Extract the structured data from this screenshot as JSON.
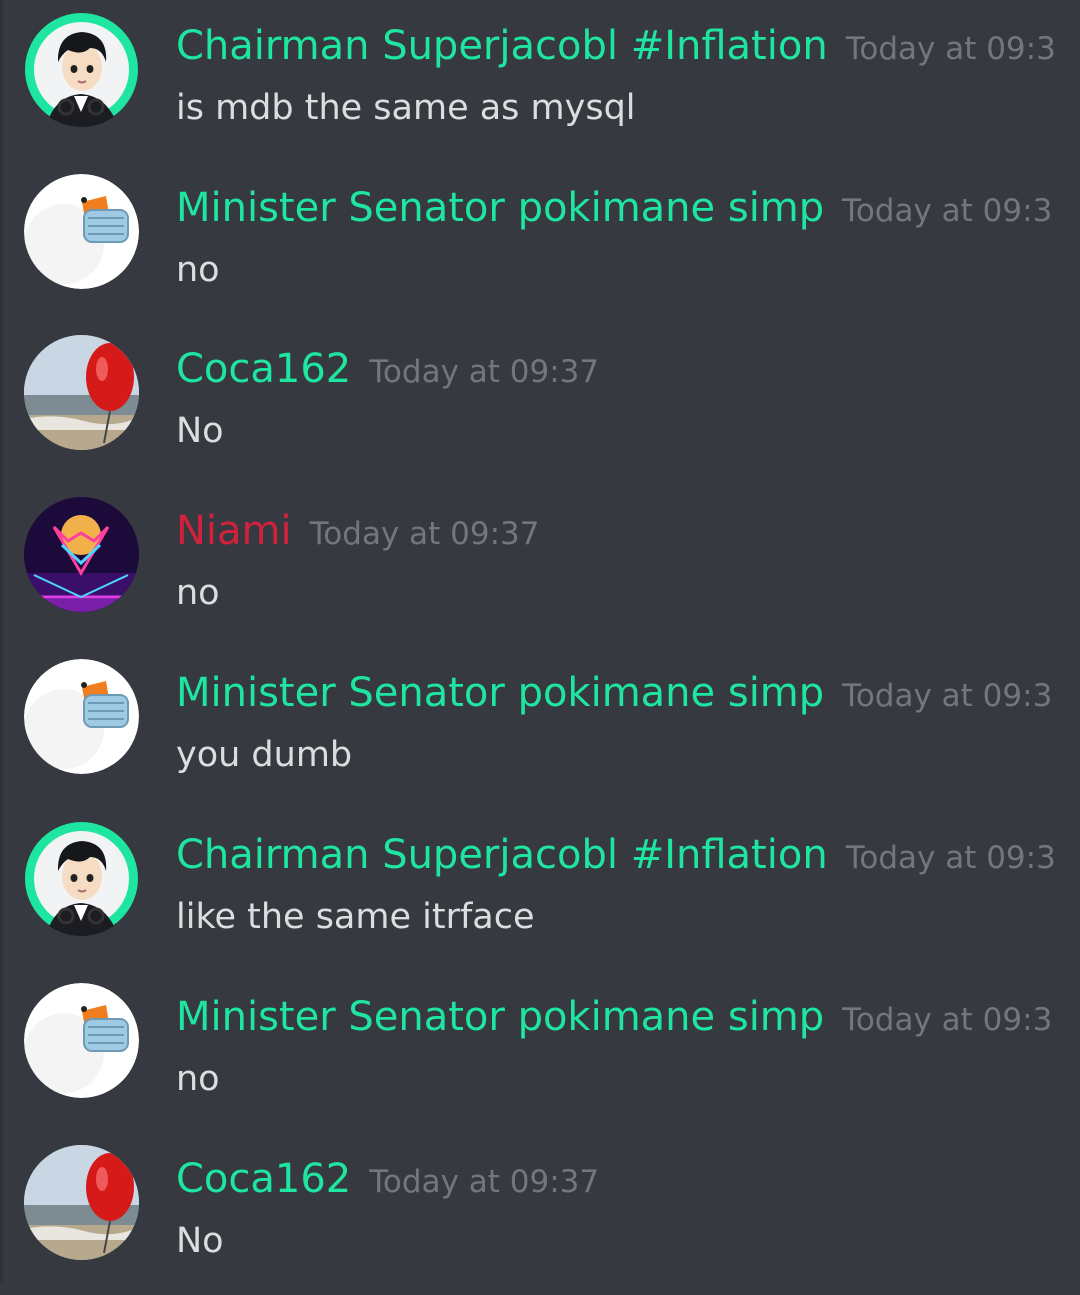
{
  "colors": {
    "background": "#36393f",
    "username_green": "#1ee6a0",
    "username_red": "#d1213c",
    "timestamp": "#72767d",
    "message_text": "#dcddde"
  },
  "messages": [
    {
      "author": "Chairman Superjacobl #Inflation",
      "author_color": "#1ee6a0",
      "timestamp": "Today at 09:3",
      "content": "is mdb the same as mysql",
      "avatar": "anime-boy-avatar"
    },
    {
      "author": "Minister Senator pokimane simp",
      "author_color": "#1ee6a0",
      "timestamp": "Today at 09:3",
      "content": "no",
      "avatar": "goose-mask-avatar"
    },
    {
      "author": "Coca162",
      "author_color": "#1ee6a0",
      "timestamp": "Today at 09:37",
      "content": "No",
      "avatar": "red-balloon-beach-avatar"
    },
    {
      "author": "Niami",
      "author_color": "#d1213c",
      "timestamp": "Today at 09:37",
      "content": "no",
      "avatar": "synthwave-wolf-avatar"
    },
    {
      "author": "Minister Senator pokimane simp",
      "author_color": "#1ee6a0",
      "timestamp": "Today at 09:3",
      "content": "you dumb",
      "avatar": "goose-mask-avatar"
    },
    {
      "author": "Chairman Superjacobl #Inflation",
      "author_color": "#1ee6a0",
      "timestamp": "Today at 09:3",
      "content": "like the same itrface",
      "avatar": "anime-boy-avatar"
    },
    {
      "author": "Minister Senator pokimane simp",
      "author_color": "#1ee6a0",
      "timestamp": "Today at 09:3",
      "content": "no",
      "avatar": "goose-mask-avatar"
    },
    {
      "author": "Coca162",
      "author_color": "#1ee6a0",
      "timestamp": "Today at 09:37",
      "content": "No",
      "avatar": "red-balloon-beach-avatar"
    }
  ]
}
